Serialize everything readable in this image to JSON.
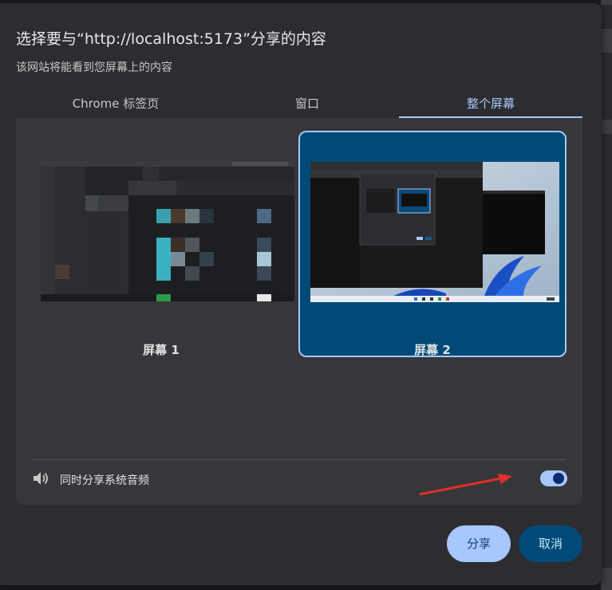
{
  "dialog": {
    "title": "选择要与“http://localhost:5173”分享的内容",
    "subtitle": "该网站将能看到您屏幕上的内容"
  },
  "tabs": [
    {
      "label": "Chrome 标签页",
      "active": false
    },
    {
      "label": "窗口",
      "active": false
    },
    {
      "label": "整个屏幕",
      "active": true
    }
  ],
  "screens": [
    {
      "label": "屏幕 1",
      "selected": false
    },
    {
      "label": "屏幕 2",
      "selected": true
    }
  ],
  "audio": {
    "label": "同时分享系统音频",
    "enabled": true,
    "icon": "speaker-icon"
  },
  "buttons": {
    "share": "分享",
    "cancel": "取消"
  },
  "colors": {
    "accent": "#a8c7fa",
    "selected_card": "#004a77",
    "annotation_arrow": "#e0302a"
  }
}
